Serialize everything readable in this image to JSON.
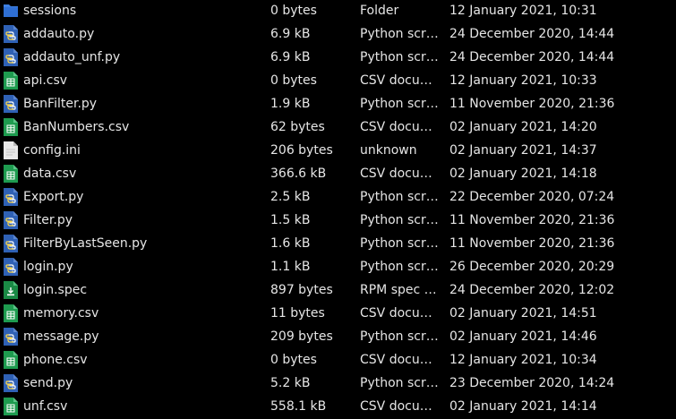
{
  "files": [
    {
      "name": "sessions",
      "size": "0 bytes",
      "type": "Folder",
      "modified": "12 January 2021, 10:31",
      "icon": "folder-icon"
    },
    {
      "name": "addauto.py",
      "size": "6.9 kB",
      "type": "Python script",
      "modified": "24 December 2020, 14:44",
      "icon": "python-file-icon"
    },
    {
      "name": "addauto_unf.py",
      "size": "6.9 kB",
      "type": "Python script",
      "modified": "24 December 2020, 14:44",
      "icon": "python-file-icon"
    },
    {
      "name": "api.csv",
      "size": "0 bytes",
      "type": "CSV document",
      "modified": "12 January 2021, 10:33",
      "icon": "csv-file-icon"
    },
    {
      "name": "BanFilter.py",
      "size": "1.9 kB",
      "type": "Python script",
      "modified": "11 November 2020, 21:36",
      "icon": "python-file-icon"
    },
    {
      "name": "BanNumbers.csv",
      "size": "62 bytes",
      "type": "CSV document",
      "modified": "02 January 2021, 14:20",
      "icon": "csv-file-icon"
    },
    {
      "name": "config.ini",
      "size": "206 bytes",
      "type": "unknown",
      "modified": "02 January 2021, 14:37",
      "icon": "text-file-icon"
    },
    {
      "name": "data.csv",
      "size": "366.6 kB",
      "type": "CSV document",
      "modified": "02 January 2021, 14:18",
      "icon": "csv-file-icon"
    },
    {
      "name": "Export.py",
      "size": "2.5 kB",
      "type": "Python script",
      "modified": "22 December 2020, 07:24",
      "icon": "python-file-icon"
    },
    {
      "name": "Filter.py",
      "size": "1.5 kB",
      "type": "Python script",
      "modified": "11 November 2020, 21:36",
      "icon": "python-file-icon"
    },
    {
      "name": "FilterByLastSeen.py",
      "size": "1.6 kB",
      "type": "Python script",
      "modified": "11 November 2020, 21:36",
      "icon": "python-file-icon"
    },
    {
      "name": "login.py",
      "size": "1.1 kB",
      "type": "Python script",
      "modified": "26 December 2020, 20:29",
      "icon": "python-file-icon"
    },
    {
      "name": "login.spec",
      "size": "897 bytes",
      "type": "RPM spec file",
      "modified": "24 December 2020, 12:02",
      "icon": "spec-file-icon"
    },
    {
      "name": "memory.csv",
      "size": "11 bytes",
      "type": "CSV document",
      "modified": "02 January 2021, 14:51",
      "icon": "csv-file-icon"
    },
    {
      "name": "message.py",
      "size": "209 bytes",
      "type": "Python script",
      "modified": "02 January 2021, 14:46",
      "icon": "python-file-icon"
    },
    {
      "name": "phone.csv",
      "size": "0 bytes",
      "type": "CSV document",
      "modified": "12 January 2021, 10:34",
      "icon": "csv-file-icon"
    },
    {
      "name": "send.py",
      "size": "5.2 kB",
      "type": "Python script",
      "modified": "23 December 2020, 14:24",
      "icon": "python-file-icon"
    },
    {
      "name": "unf.csv",
      "size": "558.1 kB",
      "type": "CSV document",
      "modified": "02 January 2021, 14:14",
      "icon": "csv-file-icon"
    }
  ],
  "colors": {
    "background": "#000000",
    "text": "#e6e6e6",
    "folder": "#3d7fe0",
    "python": "#2f61b5",
    "csv": "#1e9b4f",
    "spec": "#1a8a45",
    "text_file": "#e8e8e8"
  }
}
